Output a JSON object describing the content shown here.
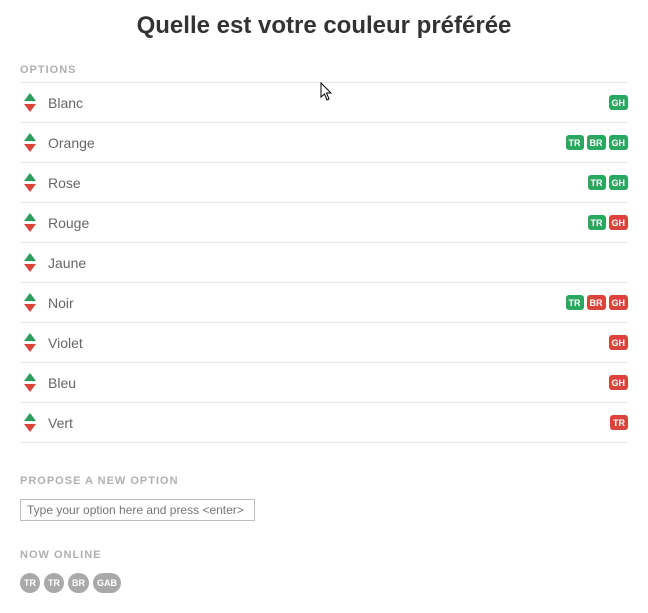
{
  "title": "Quelle est votre couleur préférée",
  "labels": {
    "options": "OPTIONS",
    "propose": "PROPOSE A NEW OPTION",
    "now_online": "NOW ONLINE"
  },
  "options": [
    {
      "name": "Blanc",
      "votes": [
        {
          "text": "GH",
          "color": "green"
        }
      ]
    },
    {
      "name": "Orange",
      "votes": [
        {
          "text": "TR",
          "color": "green"
        },
        {
          "text": "BR",
          "color": "green"
        },
        {
          "text": "GH",
          "color": "green"
        }
      ]
    },
    {
      "name": "Rose",
      "votes": [
        {
          "text": "TR",
          "color": "green"
        },
        {
          "text": "GH",
          "color": "green"
        }
      ]
    },
    {
      "name": "Rouge",
      "votes": [
        {
          "text": "TR",
          "color": "green"
        },
        {
          "text": "GH",
          "color": "red"
        }
      ]
    },
    {
      "name": "Jaune",
      "votes": []
    },
    {
      "name": "Noir",
      "votes": [
        {
          "text": "TR",
          "color": "green"
        },
        {
          "text": "BR",
          "color": "red"
        },
        {
          "text": "GH",
          "color": "red"
        }
      ]
    },
    {
      "name": "Violet",
      "votes": [
        {
          "text": "GH",
          "color": "red"
        }
      ]
    },
    {
      "name": "Bleu",
      "votes": [
        {
          "text": "GH",
          "color": "red"
        }
      ]
    },
    {
      "name": "Vert",
      "votes": [
        {
          "text": "TR",
          "color": "red"
        }
      ]
    }
  ],
  "propose": {
    "placeholder": "Type your option here and press <enter>",
    "value": ""
  },
  "online": [
    "TR",
    "TR",
    "BR",
    "GAB"
  ]
}
